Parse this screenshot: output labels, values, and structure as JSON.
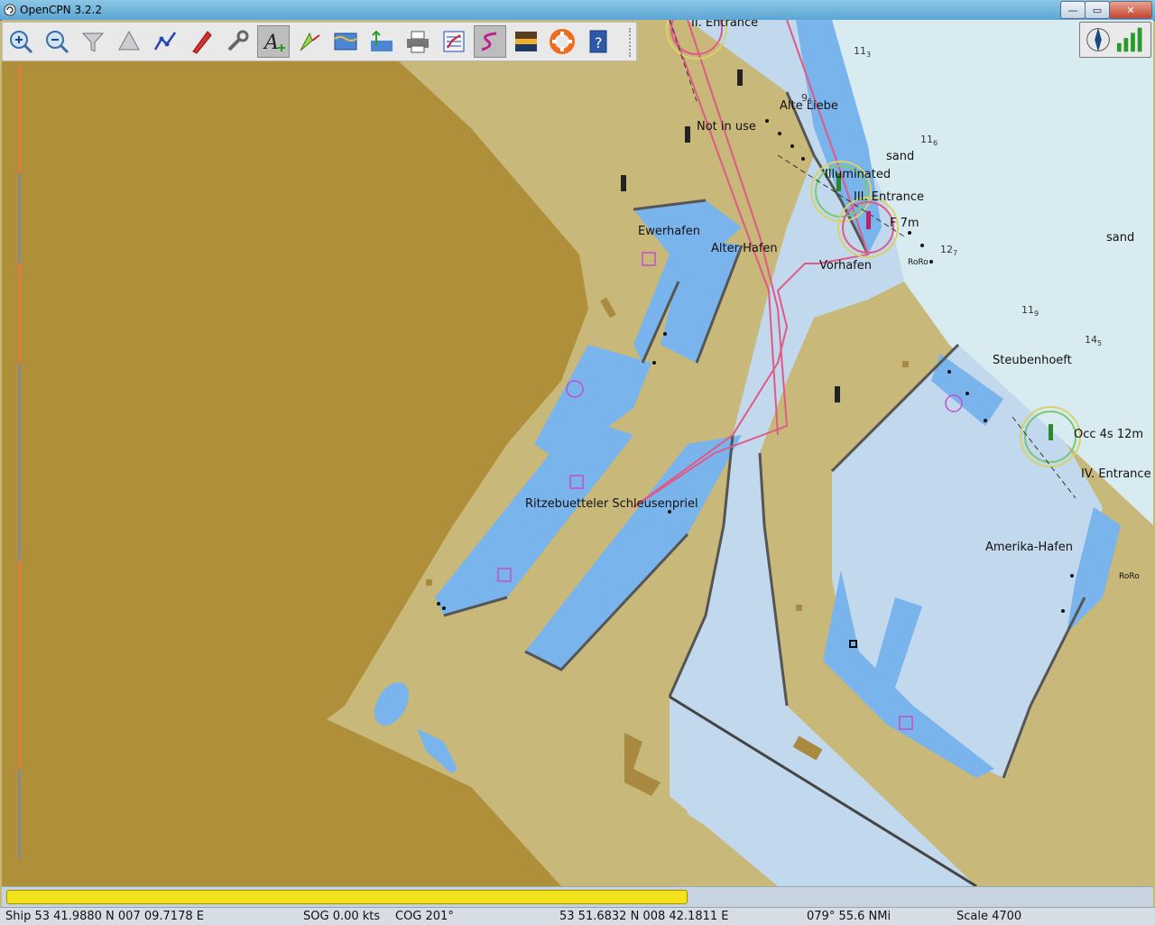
{
  "window": {
    "title": "OpenCPN 3.2.2",
    "minimize": "—",
    "maximize": "▭",
    "close": "✕"
  },
  "toolbar": {
    "buttons": [
      {
        "name": "zoom-in",
        "icon": "zoom-in-icon"
      },
      {
        "name": "zoom-out",
        "icon": "zoom-out-icon"
      },
      {
        "name": "scale-in",
        "icon": "funnel-icon"
      },
      {
        "name": "scale-out",
        "icon": "cone-icon"
      },
      {
        "name": "route",
        "icon": "route-icon"
      },
      {
        "name": "follow",
        "icon": "ship-icon"
      },
      {
        "name": "settings",
        "icon": "wrench-icon"
      },
      {
        "name": "text",
        "icon": "text-icon",
        "active": true
      },
      {
        "name": "current",
        "icon": "current-icon"
      },
      {
        "name": "tide",
        "icon": "tide-icon"
      },
      {
        "name": "tide-graph",
        "icon": "tide-graph-icon"
      },
      {
        "name": "print",
        "icon": "printer-icon"
      },
      {
        "name": "route-manager",
        "icon": "route-manager-icon"
      },
      {
        "name": "track",
        "icon": "track-icon",
        "active": true
      },
      {
        "name": "color-scheme",
        "icon": "sunset-icon"
      },
      {
        "name": "mob",
        "icon": "lifebuoy-icon"
      },
      {
        "name": "help",
        "icon": "help-icon"
      }
    ],
    "accent": "#e9e9e9"
  },
  "colors": {
    "land": "#c8b87a",
    "land_dark": "#b0903c",
    "water_shallow": "#79b4ec",
    "water_mid": "#c2d9ee",
    "water_deep": "#d9ecf1",
    "route": "#e05a86",
    "progress": "#f4e21c"
  },
  "map": {
    "labels": [
      {
        "name": "label-entrance-top",
        "text": "II. Entrance"
      },
      {
        "name": "label-alte-liebe",
        "text": "Alte Liebe"
      },
      {
        "name": "label-not-in-use",
        "text": "Not in use"
      },
      {
        "name": "label-sand-1",
        "text": "sand"
      },
      {
        "name": "label-illuminated",
        "text": "Illuminated"
      },
      {
        "name": "label-iii-entrance",
        "text": "III. Entrance"
      },
      {
        "name": "label-f7m",
        "text": "F 7m"
      },
      {
        "name": "label-sand-2",
        "text": "sand"
      },
      {
        "name": "label-ewerhafen",
        "text": "Ewerhafen"
      },
      {
        "name": "label-alter-hafen",
        "text": "Alter Hafen"
      },
      {
        "name": "label-vorhafen",
        "text": "Vorhafen"
      },
      {
        "name": "label-roro-1",
        "text": "RoRo"
      },
      {
        "name": "label-steubenhoeft",
        "text": "Steubenhoeft"
      },
      {
        "name": "label-occ",
        "text": "Occ 4s 12m"
      },
      {
        "name": "label-iv-entrance",
        "text": "IV. Entrance"
      },
      {
        "name": "label-ritzebuetteler",
        "text": "Ritzebuetteler Schleusenpriel"
      },
      {
        "name": "label-amerika-hafen",
        "text": "Amerika-Hafen"
      },
      {
        "name": "label-roro-2",
        "text": "RoRo"
      }
    ],
    "soundings": [
      {
        "name": "depth-113",
        "main": "11",
        "sub": "3"
      },
      {
        "name": "depth-116",
        "main": "11",
        "sub": "6"
      },
      {
        "name": "depth-127",
        "main": "12",
        "sub": "7"
      },
      {
        "name": "depth-119",
        "main": "11",
        "sub": "9"
      },
      {
        "name": "depth-145",
        "main": "14",
        "sub": "5"
      },
      {
        "name": "depth-95",
        "main": "9",
        "sub": "5"
      }
    ]
  },
  "progress": {
    "fraction": 0.595
  },
  "status": {
    "ship": "Ship 53 41.9880 N   007 09.7178 E",
    "sog": "SOG 0.00 kts",
    "cog": "COG 201°",
    "cursor": "53 51.6832 N   008 42.1811 E",
    "bearing_range": "079°  55.6 NMi",
    "scale": "Scale 4700"
  }
}
